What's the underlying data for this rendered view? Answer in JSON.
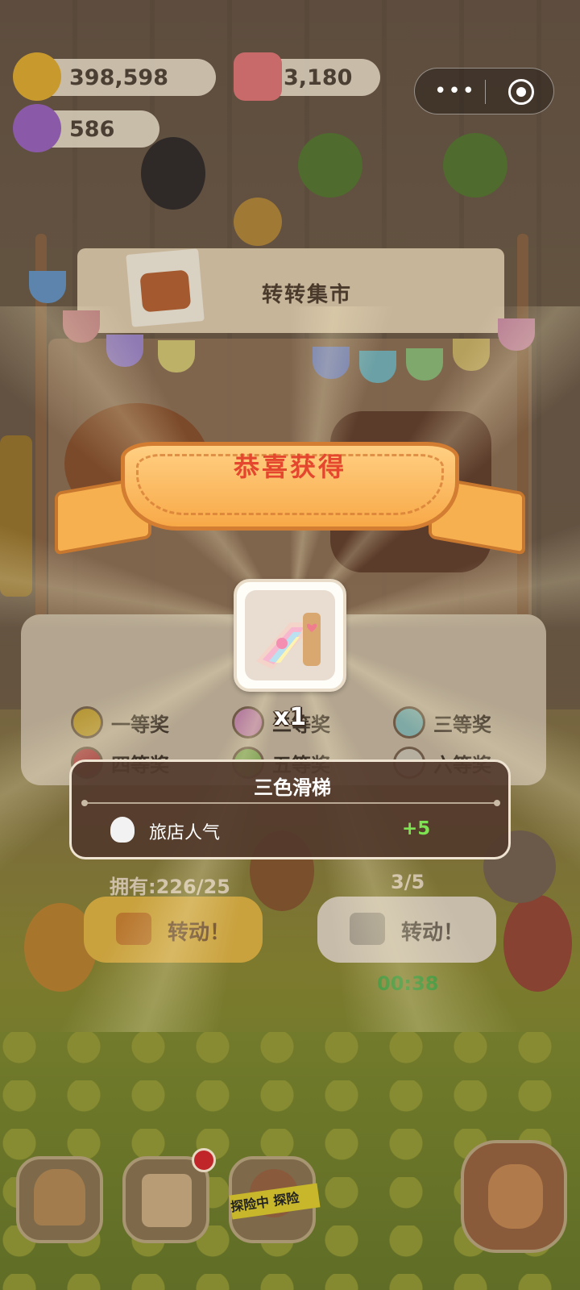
{
  "hud": {
    "coins": "398,598",
    "gems": "3,180",
    "tickets": "586",
    "capsule_dots": "•••"
  },
  "stall": {
    "title": "转转集市"
  },
  "prizes": [
    {
      "label": "一等奖",
      "color": "#e0b63b"
    },
    {
      "label": "二等奖",
      "color": "#e49cc4"
    },
    {
      "label": "三等奖",
      "color": "#8fd6d0"
    },
    {
      "label": "四等奖",
      "color": "#d94b4b"
    },
    {
      "label": "五等奖",
      "color": "#9ed36a"
    },
    {
      "label": "六等奖",
      "color": "#e9e2d4"
    }
  ],
  "reward": {
    "banner": "恭喜获得",
    "quantity": "x1",
    "item_name": "三色滑梯",
    "stat_label": "旅店人气",
    "stat_value": "+5"
  },
  "machine": {
    "owned": "拥有:226/25",
    "count": "3/5",
    "spin_label": "转动！",
    "video_spin_label": "转动！",
    "timer": "00:38"
  },
  "nav": {
    "tape_text": "探险中 探险"
  },
  "colors": {
    "banner_orange": "#f8a948",
    "banner_text": "#e4472e",
    "stat_green": "#7ee352",
    "panel_brown": "#523a2d"
  }
}
